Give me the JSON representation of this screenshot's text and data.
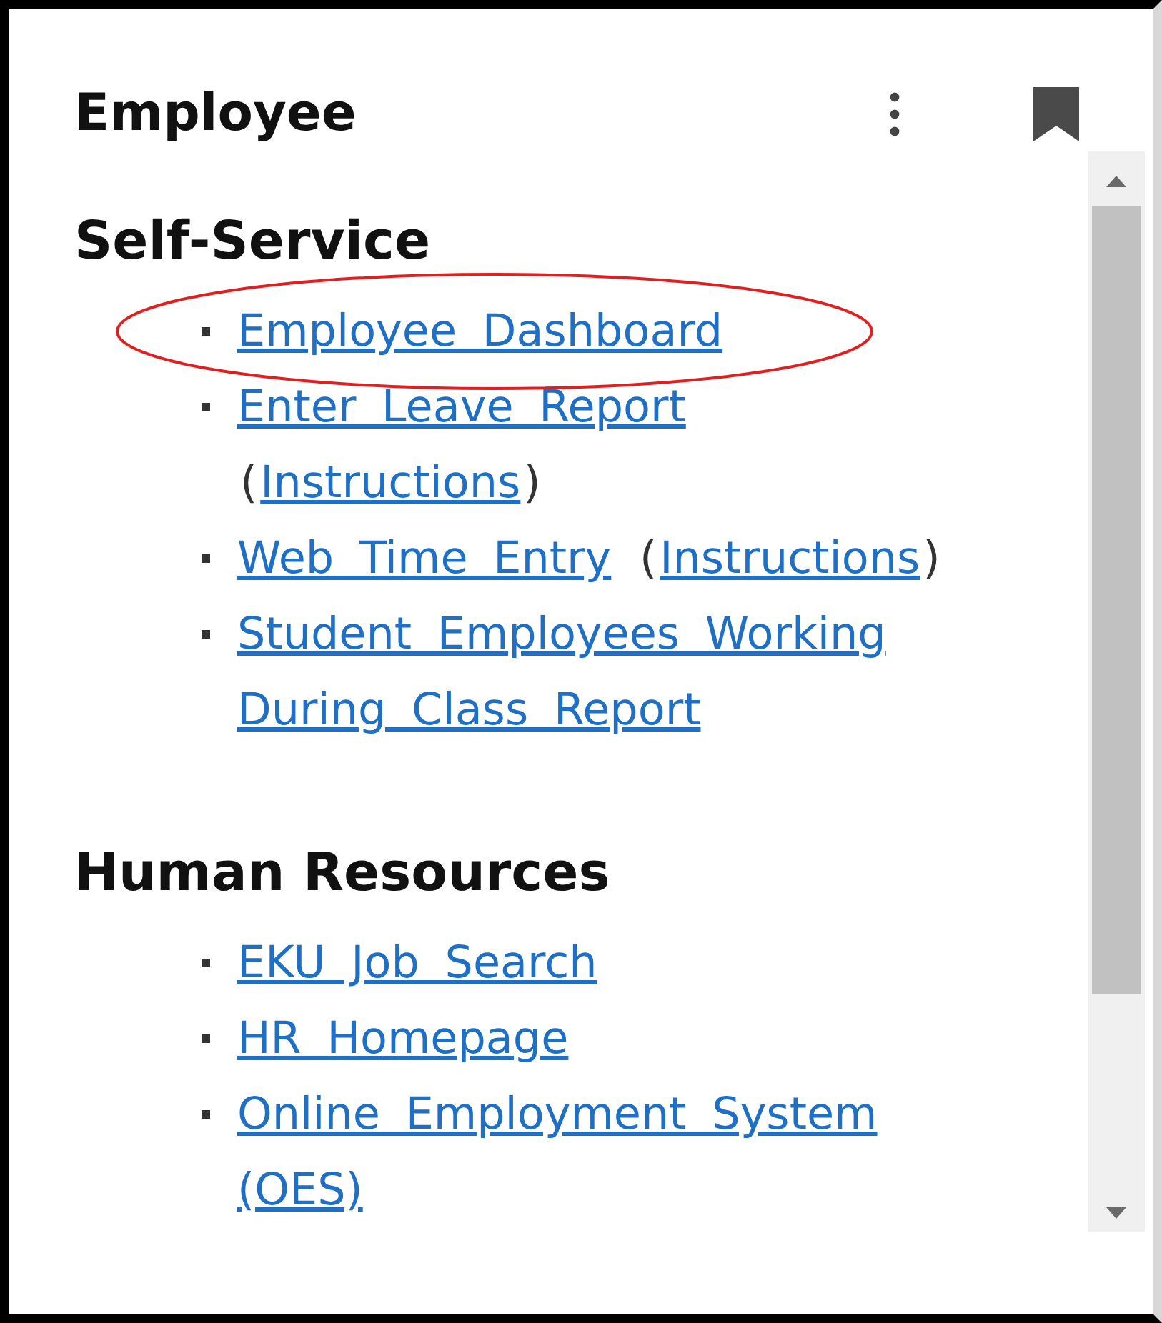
{
  "header": {
    "title": "Employee"
  },
  "sections": [
    {
      "heading": "Self-Service",
      "items": [
        {
          "circled": true,
          "parts": [
            {
              "kind": "link",
              "text": "Employee Dashboard"
            }
          ]
        },
        {
          "circled": false,
          "parts": [
            {
              "kind": "link",
              "text": "Enter Leave Report"
            },
            {
              "kind": "plain",
              "text": "("
            },
            {
              "kind": "link",
              "text": "Instructions"
            },
            {
              "kind": "plain",
              "text": ")"
            }
          ]
        },
        {
          "circled": false,
          "parts": [
            {
              "kind": "link",
              "text": "Web Time Entry"
            },
            {
              "kind": "plain",
              "text": "("
            },
            {
              "kind": "link",
              "text": "Instructions"
            },
            {
              "kind": "plain",
              "text": ")"
            }
          ]
        },
        {
          "circled": false,
          "parts": [
            {
              "kind": "link",
              "text": "Student Employees Working During Class Report"
            }
          ]
        }
      ]
    },
    {
      "heading": "Human Resources",
      "items": [
        {
          "circled": false,
          "parts": [
            {
              "kind": "link",
              "text": "EKU Job Search"
            }
          ]
        },
        {
          "circled": false,
          "parts": [
            {
              "kind": "link",
              "text": "HR Homepage"
            }
          ]
        },
        {
          "circled": false,
          "parts": [
            {
              "kind": "link",
              "text": "Online Employment System (OES)"
            }
          ]
        }
      ]
    }
  ]
}
